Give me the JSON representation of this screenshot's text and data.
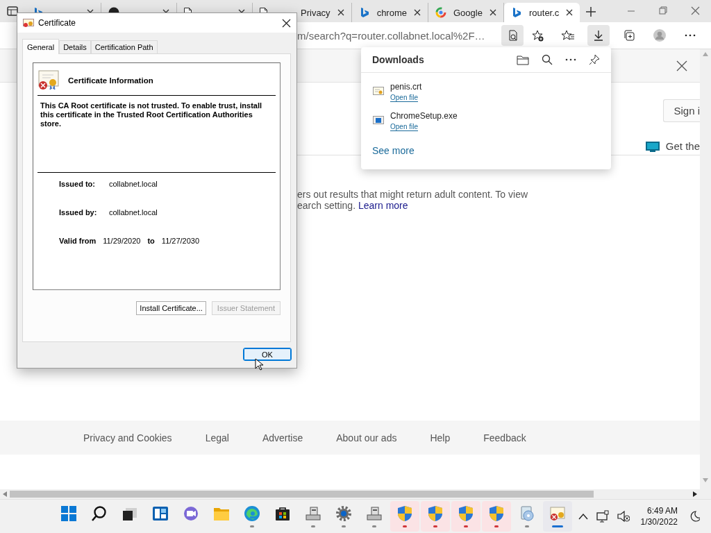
{
  "browser": {
    "tabs": [
      {
        "kind": "bing",
        "selected": false
      },
      {
        "kind": "github",
        "selected": false
      },
      {
        "kind": "doc",
        "selected": false
      },
      {
        "title": "Privacy",
        "kind": "doc",
        "selected": false
      },
      {
        "title": "chrome",
        "kind": "bing",
        "selected": false
      },
      {
        "title": "Google",
        "kind": "google",
        "selected": false
      },
      {
        "title": "router.c",
        "kind": "bing",
        "selected": true
      }
    ],
    "address": "m/search?q=router.collabnet.local%2F…"
  },
  "page": {
    "sign_in": "Sign i",
    "get_app": "Get the",
    "notice": [
      "ers out results that might return adult content. To view",
      "earch setting."
    ],
    "learn_more": "Learn more",
    "footer_links": [
      "Privacy and Cookies",
      "Legal",
      "Advertise",
      "About our ads",
      "Help",
      "Feedback"
    ]
  },
  "downloads": {
    "title": "Downloads",
    "items": [
      {
        "name": "penis.crt",
        "action": "Open file",
        "kind": "certificate"
      },
      {
        "name": "ChromeSetup.exe",
        "action": "Open file",
        "kind": "installer"
      }
    ],
    "see_more": "See more"
  },
  "dialog": {
    "title": "Certificate",
    "tabs": [
      {
        "label": "General",
        "selected": true
      },
      {
        "label": "Details",
        "selected": false
      },
      {
        "label": "Certification Path",
        "selected": false
      }
    ],
    "heading": "Certificate Information",
    "message": "This CA Root certificate is not trusted. To enable trust, install this certificate in the Trusted Root Certification Authorities store.",
    "fields": [
      {
        "label": "Issued to:",
        "value": "collabnet.local"
      },
      {
        "label": "Issued by:",
        "value": "collabnet.local"
      }
    ],
    "valid_label": "Valid from",
    "valid_from": "11/29/2020",
    "to_label": "to",
    "valid_to": "11/27/2030",
    "buttons": [
      {
        "label": "Install Certificate...",
        "disabled": false
      },
      {
        "label": "Issuer Statement",
        "disabled": true
      }
    ],
    "ok": "OK"
  },
  "taskbar": {
    "apps": [
      {
        "kind": "start",
        "running": false,
        "alert": false,
        "selected": false
      },
      {
        "kind": "search",
        "running": false,
        "alert": false,
        "selected": false
      },
      {
        "kind": "taskview",
        "running": false,
        "alert": false,
        "selected": false
      },
      {
        "kind": "widgets",
        "running": false,
        "alert": false,
        "selected": false
      },
      {
        "kind": "chat",
        "running": false,
        "alert": false,
        "selected": false
      },
      {
        "kind": "folder",
        "running": false,
        "alert": false,
        "selected": false
      },
      {
        "kind": "edge",
        "running": true,
        "alert": false,
        "selected": false
      },
      {
        "kind": "store",
        "running": false,
        "alert": false,
        "selected": false
      },
      {
        "kind": "device",
        "running": true,
        "alert": false,
        "selected": false
      },
      {
        "kind": "gear",
        "running": true,
        "alert": false,
        "selected": false
      },
      {
        "kind": "device",
        "running": true,
        "alert": false,
        "selected": false
      },
      {
        "kind": "shield",
        "running": true,
        "alert": true,
        "selected": false
      },
      {
        "kind": "shield",
        "running": true,
        "alert": true,
        "selected": false
      },
      {
        "kind": "shield",
        "running": true,
        "alert": true,
        "selected": false
      },
      {
        "kind": "shield",
        "running": true,
        "alert": true,
        "selected": false
      },
      {
        "kind": "media",
        "running": true,
        "alert": false,
        "selected": false
      },
      {
        "kind": "certificate",
        "running": true,
        "alert": false,
        "selected": true
      }
    ],
    "time": "6:49 AM",
    "date": "1/30/2022"
  }
}
